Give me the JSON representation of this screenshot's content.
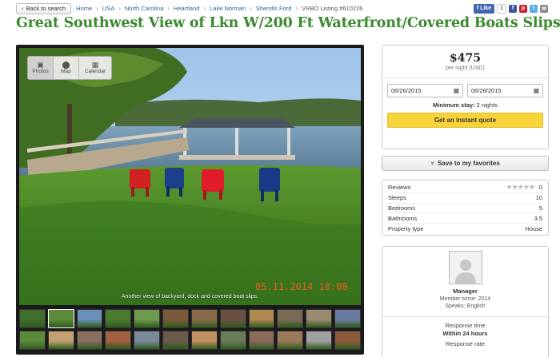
{
  "topbar": {
    "back_label": "Back to search",
    "breadcrumbs": [
      "Home",
      "USA",
      "North Carolina",
      "Heartland",
      "Lake Norman",
      "Sherrills Ford"
    ],
    "listing": "VRBO Listing #610226",
    "fb_like": "Like",
    "fb_count": "1"
  },
  "title": "Great Southwest View of Lkn W/200 Ft Waterfront/Covered Boats Slips",
  "gallery": {
    "tabs": [
      {
        "label": "Photos",
        "icon": "camera-icon"
      },
      {
        "label": "Map",
        "icon": "map-pin-icon"
      },
      {
        "label": "Calendar",
        "icon": "calendar-icon"
      }
    ],
    "caption": "Another view of backyard, dock and covered boat slips.",
    "stamp": "05.11.2014  18:08",
    "thumb_colors": [
      "#3f6f2a",
      "#5e8a3c",
      "#6b8fb8",
      "#4a7a30",
      "#6e9a4e",
      "#7a5a3a",
      "#8a6a4a",
      "#6a5040",
      "#b08850",
      "#7a6a55",
      "#9a8a70",
      "#6a7aa0",
      "#5a8a3a",
      "#c0a070",
      "#8a7060",
      "#a06040",
      "#7a8a9a",
      "#6a5a4a",
      "#c09060",
      "#6a7a5a",
      "#8a6a5a",
      "#9a7a5a",
      "#a0a0a0",
      "#8a5a3a"
    ]
  },
  "booking": {
    "price": "$475",
    "per": "per night (USD)",
    "checkin": "06/26/2015",
    "checkout": "06/28/2015",
    "min_stay_label": "Minimum stay:",
    "min_stay_value": "2 nights",
    "quote_label": "Get an instant quote"
  },
  "favorites_label": "Save to my favorites",
  "facts": [
    {
      "label": "Reviews",
      "value": "0"
    },
    {
      "label": "Sleeps",
      "value": "10"
    },
    {
      "label": "Bedrooms",
      "value": "5"
    },
    {
      "label": "Bathrooms",
      "value": "3.5"
    },
    {
      "label": "Property type",
      "value": "House"
    }
  ],
  "owner": {
    "name": "Manager",
    "since": "Member since: 2014",
    "speaks": "Speaks: English",
    "response_time_label": "Response time",
    "response_time_value": "Within 24 hours",
    "response_rate_label": "Response rate"
  }
}
